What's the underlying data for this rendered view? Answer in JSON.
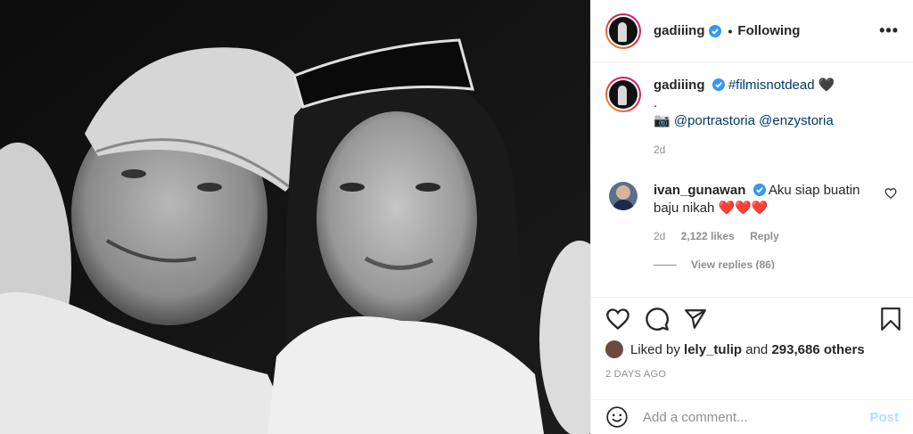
{
  "header": {
    "username": "gadiiing",
    "separator": "•",
    "follow_status": "Following",
    "more_label": "•••"
  },
  "caption": {
    "username": "gadiiing",
    "hashtag": "#filmisnotdead",
    "heart": "🖤",
    "line2": ".",
    "camera": "📷",
    "mentions": "@portrastoria @enzystoria",
    "age": "2d"
  },
  "comment": {
    "username": "ivan_gunawan",
    "text": "Aku siap buatin baju nikah ❤️❤️❤️",
    "age": "2d",
    "likes": "2,122 likes",
    "reply": "Reply",
    "view_replies": "View replies (86)"
  },
  "likes": {
    "prefix": "Liked by",
    "user": "lely_tulip",
    "joiner": "and",
    "others": "293,686 others"
  },
  "timestamp": "2 DAYS AGO",
  "add_comment": {
    "placeholder": "Add a comment...",
    "post_label": "Post"
  },
  "icons": {
    "like": "heart-icon",
    "comment": "comment-icon",
    "share": "share-icon",
    "save": "bookmark-icon",
    "emoji": "emoji-icon",
    "verified": "verified-icon"
  },
  "colors": {
    "verified": "#3897f0",
    "link": "#00376b",
    "muted": "#8e8e8e",
    "post_disabled": "#b2dffc"
  }
}
